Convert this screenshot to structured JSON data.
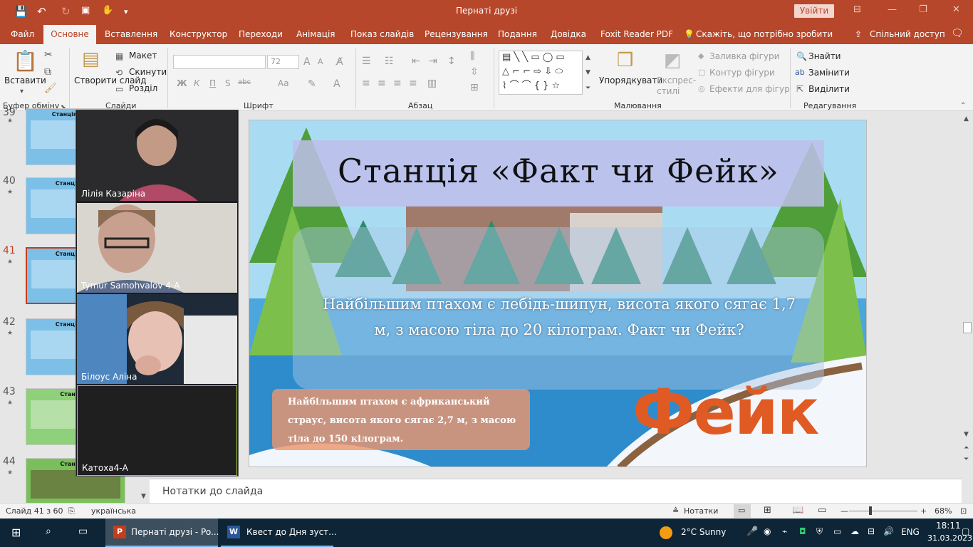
{
  "window": {
    "title": "Пернаті друзі",
    "signin_label": "Увійти",
    "qa_save": "💾",
    "qa_undo": "↶",
    "qa_redo": "↻",
    "qa_more": "▾"
  },
  "ribbon_tabs": [
    "Файл",
    "Основне",
    "Вставлення",
    "Конструктор",
    "Переходи",
    "Анімація",
    "Показ слайдів",
    "Рецензування",
    "Подання",
    "Довідка",
    "Foxit Reader PDF",
    "Скажіть, що потрібно зробити",
    "Спільний доступ"
  ],
  "ribbon": {
    "paste": "Вставити",
    "new_slide": "Створити слайд",
    "layout": "Макет",
    "reset": "Скинути",
    "section": "Розділ",
    "font_size": "72",
    "arrange": "Упорядкувати",
    "quick_styles": "Експрес-стилі",
    "shape_fill": "Заливка фігури",
    "shape_outline": "Контур фігури",
    "shape_effects": "Ефекти для фігур",
    "find": "Знайти",
    "replace": "Замінити",
    "select": "Виділити",
    "groups": {
      "clipboard": "Буфер обміну",
      "slides": "Слайди",
      "font": "Шрифт",
      "paragraph": "Абзац",
      "drawing": "Малювання",
      "editing": "Редагування"
    },
    "font_buttons": [
      "Ж",
      "К",
      "П",
      "S",
      "abc",
      "Аа"
    ]
  },
  "slides": {
    "items": [
      {
        "num": "39",
        "title": "Станція «Факт"
      },
      {
        "num": "40",
        "title": "Станція «Фа"
      },
      {
        "num": "41",
        "title": "Станція «Фа"
      },
      {
        "num": "42",
        "title": "Станція «Фа"
      },
      {
        "num": "43",
        "title": "Станція «"
      },
      {
        "num": "44",
        "title": "Станція «"
      }
    ],
    "active": "41"
  },
  "participants": [
    {
      "name": "Лілія Казаріна"
    },
    {
      "name": "Tymur Samohvalov 4-А"
    },
    {
      "name": "Білоус Аліна"
    },
    {
      "name": "Катоха4-А"
    }
  ],
  "slide": {
    "title": "Станція «Факт чи Фейк»",
    "question": "Найбільшим птахом є лебідь-шипун, висота якого сягає 1,7 м, з масою тіла до 20 кілограм. Факт чи Фейк?",
    "answer": "Найбільшим птахом є африканський страус, висота якого сягає 2,7 м, з масою тіла до 150 кілограм.",
    "verdict": "Фейк"
  },
  "notes_placeholder": "Нотатки до слайда",
  "status": {
    "slide_counter": "Слайд 41 з 60",
    "language": "українська",
    "notes_btn": "Нотатки",
    "zoom": "68%"
  },
  "taskbar": {
    "app1": "Пернаті друзі - Po...",
    "app2": "Квест  до Дня зуст...",
    "weather": "2°C  Sunny",
    "lang": "ENG",
    "time": "18:11",
    "date": "31.03.2023"
  }
}
